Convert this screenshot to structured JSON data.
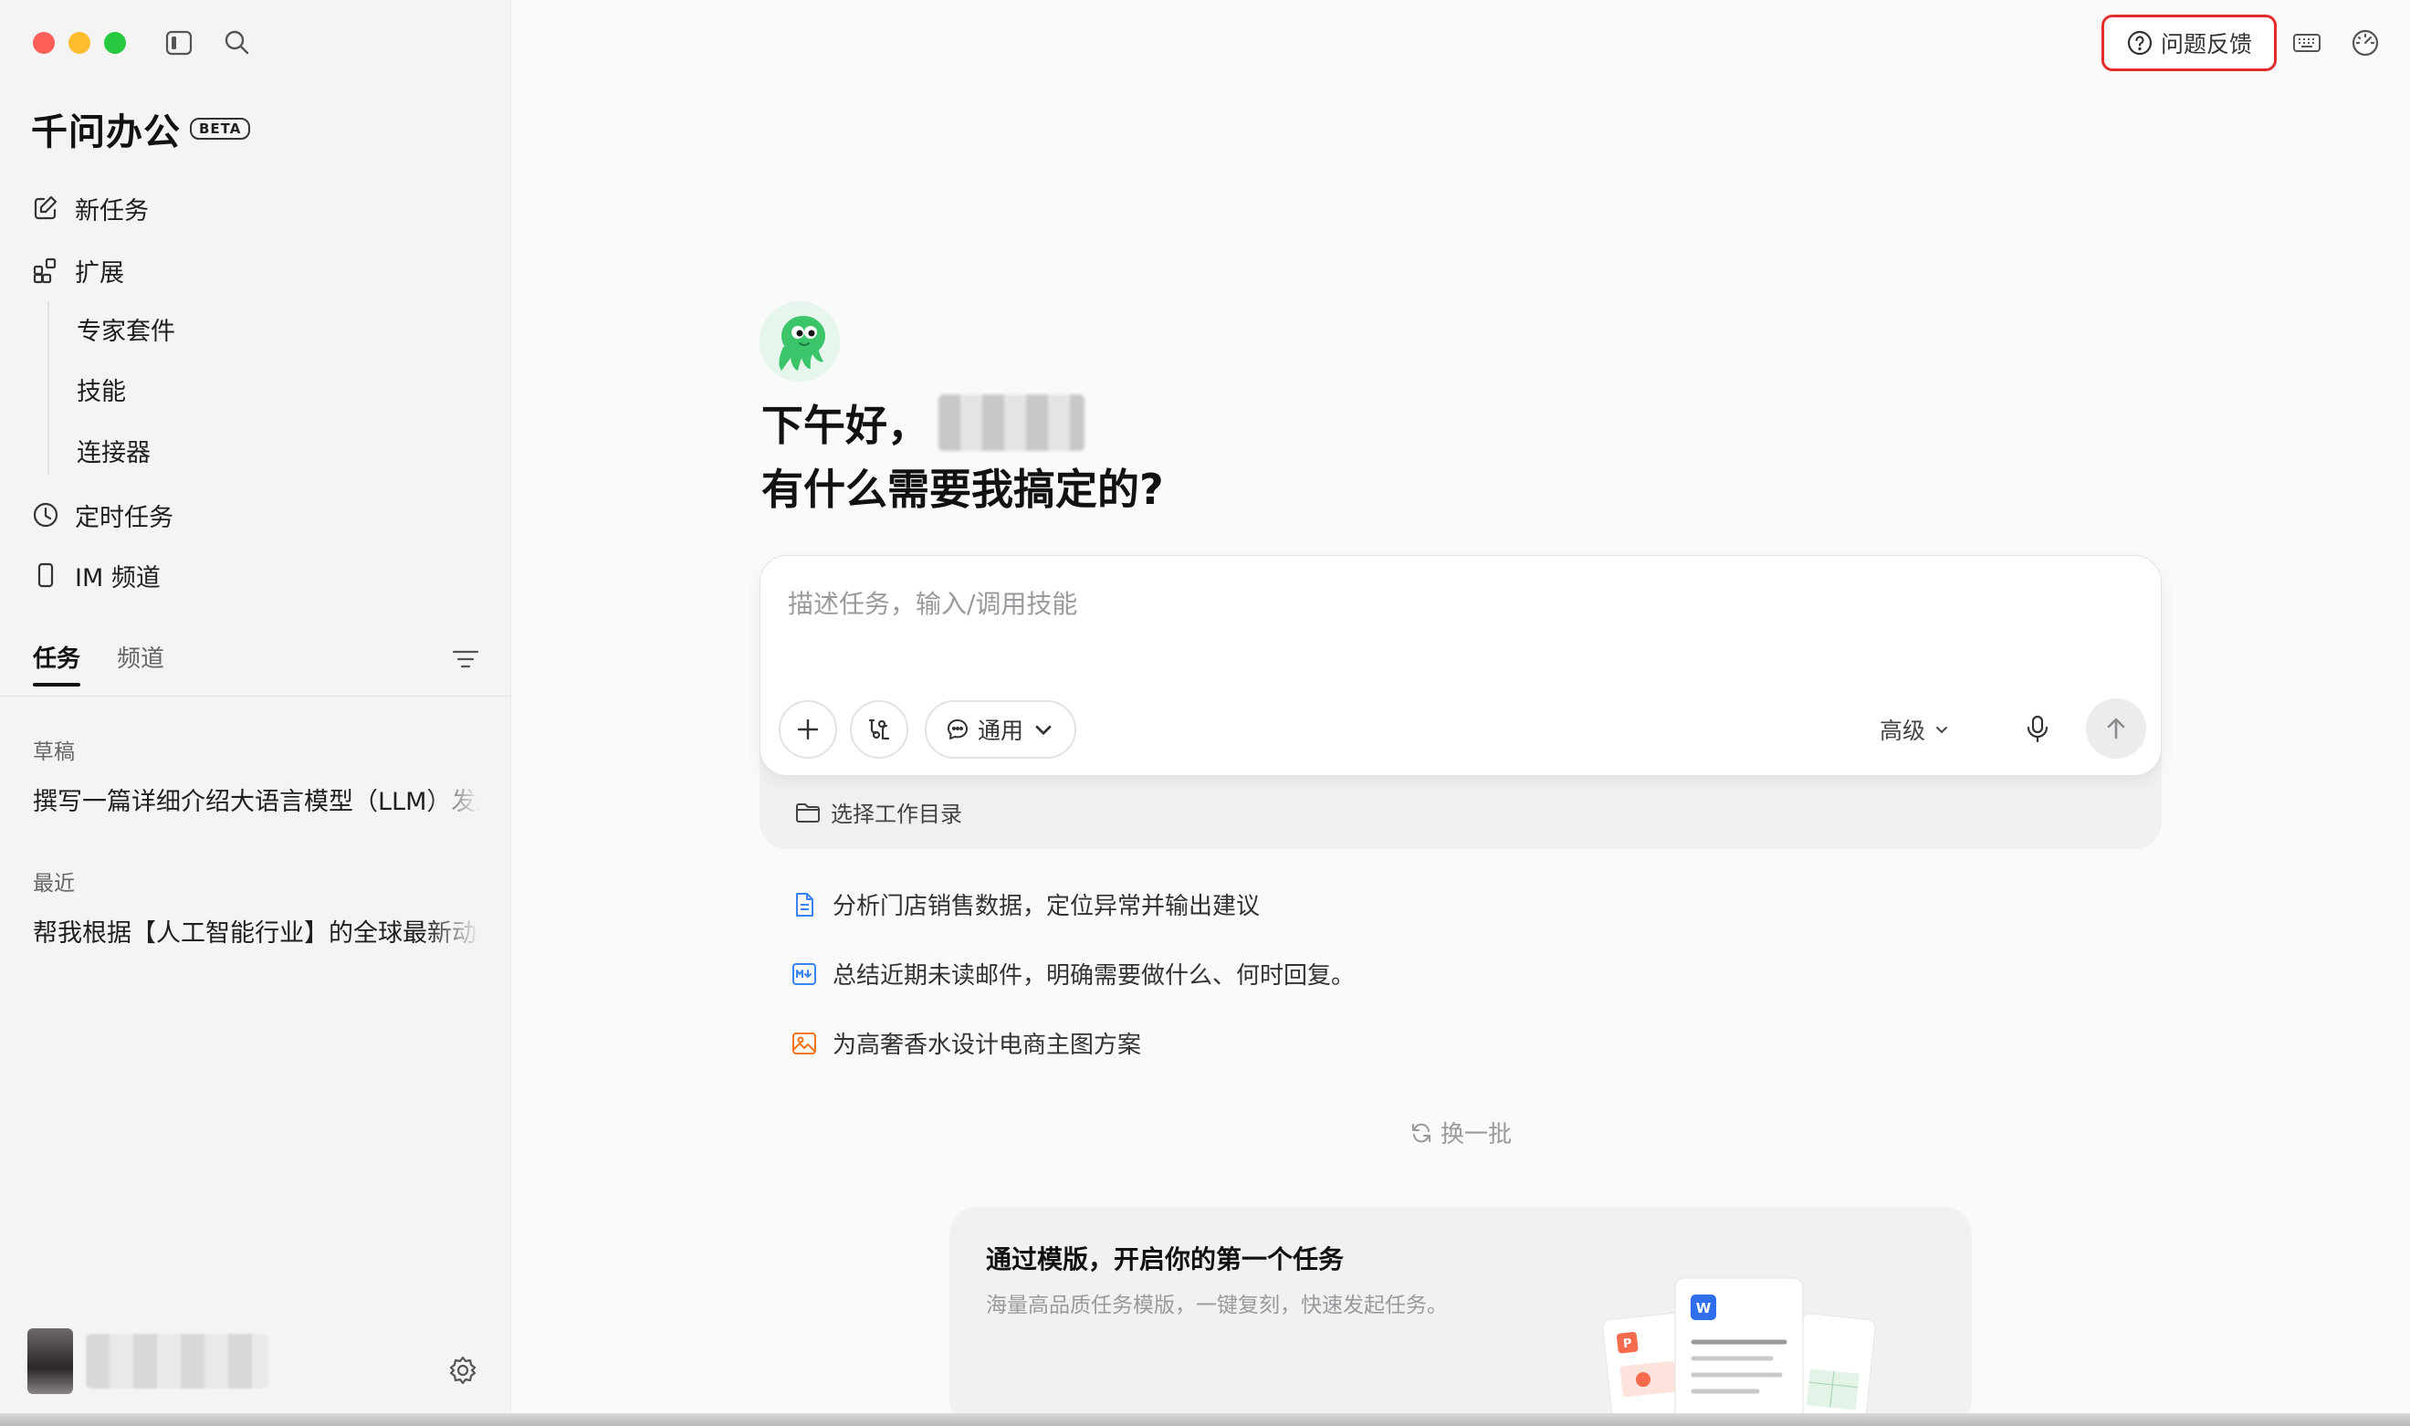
{
  "app": {
    "title": "千问办公",
    "badge": "BETA"
  },
  "sidebar": {
    "nav": {
      "new_task": "新任务",
      "extensions": "扩展",
      "extension_items": [
        "专家套件",
        "技能",
        "连接器"
      ],
      "scheduled": "定时任务",
      "im_channel": "IM 频道"
    },
    "tabs": [
      "任务",
      "频道"
    ],
    "active_tab": "任务",
    "drafts_label": "草稿",
    "drafts": [
      "撰写一篇详细介绍大语言模型（LLM）发展"
    ],
    "recent_label": "最近",
    "recent": [
      "帮我根据【人工智能行业】的全球最新动态"
    ]
  },
  "topbar": {
    "feedback_label": "问题反馈",
    "feedback_highlight_color": "#e42c2c",
    "icons": [
      "keyboard-icon",
      "gauge-icon"
    ]
  },
  "main": {
    "greeting_line1": "下午好，",
    "greeting_line2": "有什么需要我搞定的?",
    "composer": {
      "placeholder": "描述任务，输入/调用技能",
      "mode_label": "通用",
      "advanced_label": "高级",
      "workdir_label": "选择工作目录"
    },
    "suggestions": [
      {
        "icon": "document-icon",
        "icon_color": "#3b82f6",
        "text": "分析门店销售数据，定位异常并输出建议"
      },
      {
        "icon": "markdown-icon",
        "icon_color": "#3b82f6",
        "text": "总结近期未读邮件，明确需要做什么、何时回复。"
      },
      {
        "icon": "image-icon",
        "icon_color": "#f97316",
        "text": "为高奢香水设计电商主图方案"
      }
    ],
    "refresh_label": "换一批",
    "template_card": {
      "title": "通过模版，开启你的第一个任务",
      "subtitle": "海量高品质任务模版，一键复刻，快速发起任务。"
    }
  }
}
